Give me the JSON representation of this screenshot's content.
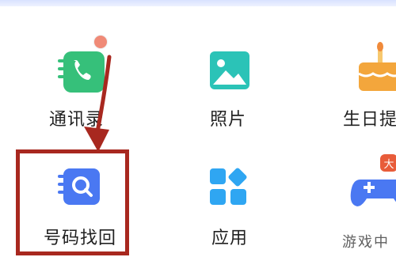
{
  "grid": {
    "row1": [
      {
        "label": "通讯录",
        "icon": "contacts-icon",
        "color": "#36c07a"
      },
      {
        "label": "照片",
        "icon": "photo-icon",
        "color": "#2bc3b7"
      },
      {
        "label": "生日提",
        "icon": "birthday-cake-icon",
        "color": "#f3a63c"
      }
    ],
    "row2": [
      {
        "label": "号码找回",
        "icon": "number-recovery-icon",
        "color": "#4a78f2"
      },
      {
        "label": "应用",
        "icon": "apps-icon",
        "color": "#2fa6f2"
      },
      {
        "label": "",
        "icon": "game-controller-icon",
        "color": "#4a78f2"
      }
    ]
  },
  "badges": {
    "new_badge_text": "大"
  },
  "watermark": "游戏中",
  "colors": {
    "annotation_red": "#a8281f",
    "notification_dot": "#f08a77"
  }
}
